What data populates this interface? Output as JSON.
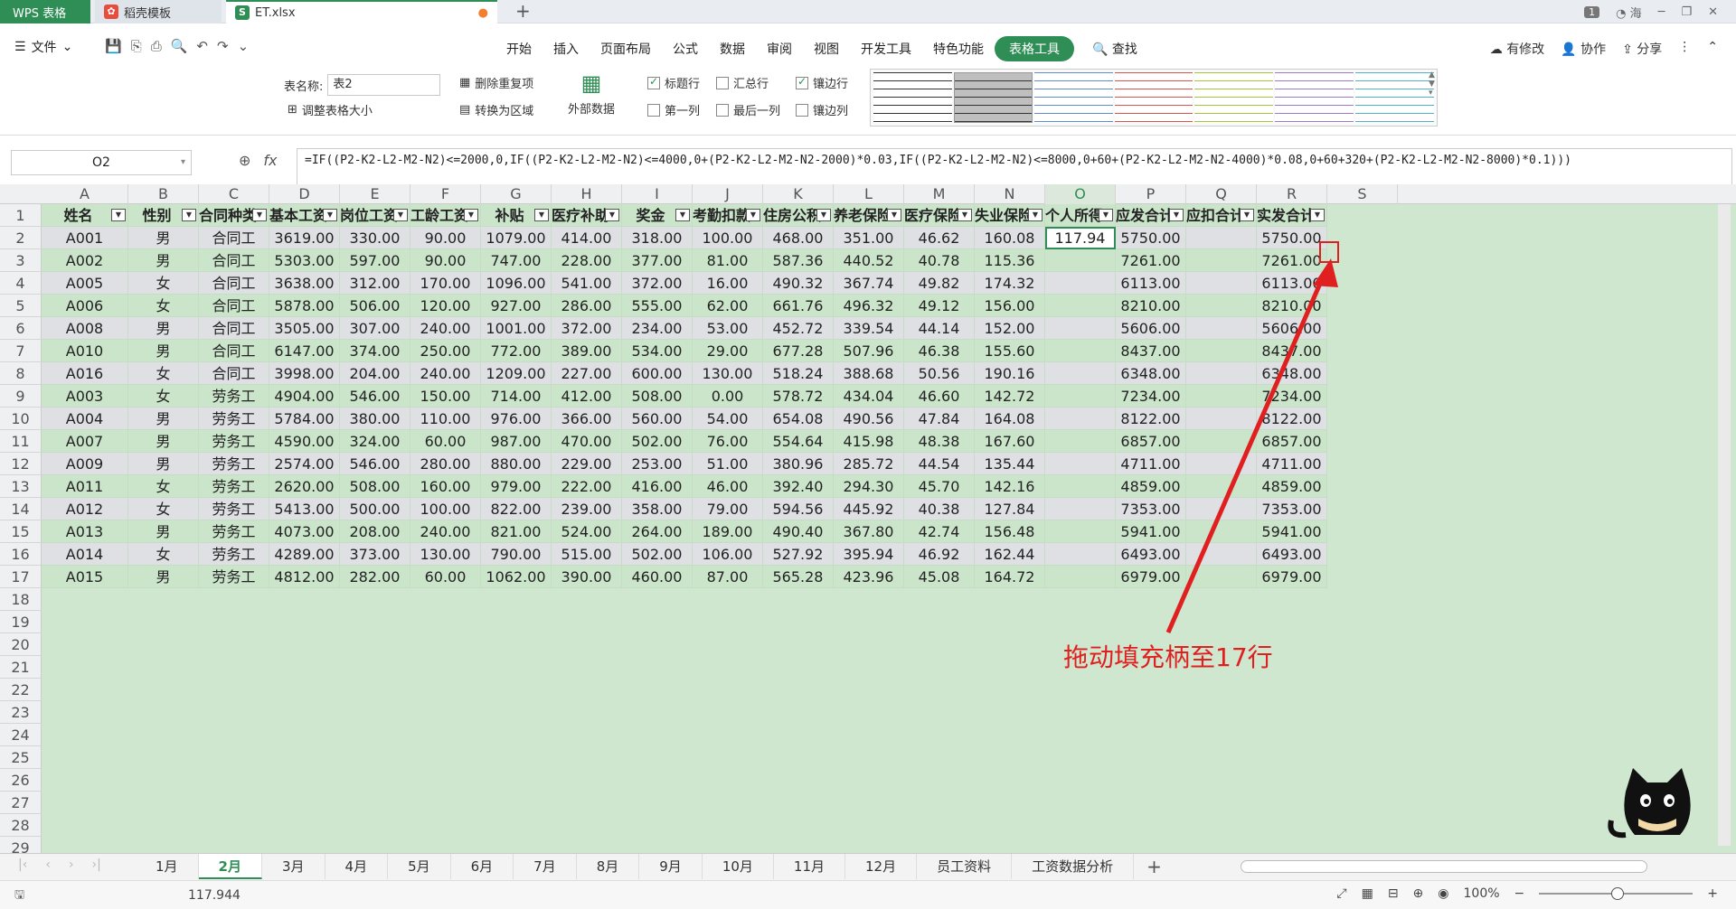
{
  "tabs": {
    "wps": "WPS 表格",
    "daoke": "稻壳模板",
    "file": "ET.xlsx",
    "badge": "1",
    "user": "海"
  },
  "menu": {
    "file": "文件",
    "ribbon_tabs": [
      "开始",
      "插入",
      "页面布局",
      "公式",
      "数据",
      "审阅",
      "视图",
      "开发工具",
      "特色功能",
      "表格工具"
    ],
    "search": "查找",
    "right": [
      "有修改",
      "协作",
      "分享"
    ]
  },
  "ribbon": {
    "table_name_label": "表名称:",
    "table_name_value": "表2",
    "resize": "调整表格大小",
    "remove_dup": "删除重复项",
    "to_range": "转换为区域",
    "external": "外部数据",
    "checks": [
      {
        "label": "标题行",
        "on": true
      },
      {
        "label": "汇总行",
        "on": false
      },
      {
        "label": "镶边行",
        "on": true
      },
      {
        "label": "第一列",
        "on": false
      },
      {
        "label": "最后一列",
        "on": false
      },
      {
        "label": "镶边列",
        "on": false
      }
    ],
    "style_colors": [
      "#333333",
      "#333333",
      "#5b8fd0",
      "#d9534f",
      "#a4c639",
      "#9b7bc8",
      "#4fb3c8"
    ]
  },
  "formula_bar": {
    "name_box": "O2",
    "formula": "=IF((P2-K2-L2-M2-N2)<=2000,0,IF((P2-K2-L2-M2-N2)<=4000,0+(P2-K2-L2-M2-N2-2000)*0.03,IF((P2-K2-L2-M2-N2)<=8000,0+60+(P2-K2-L2-M2-N2-4000)*0.08,0+60+320+(P2-K2-L2-M2-N2-8000)*0.1)))"
  },
  "columns": [
    "A",
    "B",
    "C",
    "D",
    "E",
    "F",
    "G",
    "H",
    "I",
    "J",
    "K",
    "L",
    "M",
    "N",
    "O",
    "P",
    "Q",
    "R",
    "S"
  ],
  "headers": [
    "姓名",
    "性别",
    "合同种类",
    "基本工资",
    "岗位工资",
    "工龄工资",
    "补贴",
    "医疗补助",
    "奖金",
    "考勤扣款",
    "住房公积",
    "养老保险",
    "医疗保险",
    "失业保险",
    "个人所得",
    "应发合计",
    "应扣合计",
    "实发合计"
  ],
  "rows": [
    [
      "A001",
      "男",
      "合同工",
      "3619.00",
      "330.00",
      "90.00",
      "1079.00",
      "414.00",
      "318.00",
      "100.00",
      "468.00",
      "351.00",
      "46.62",
      "160.08",
      "117.94",
      "5750.00",
      "",
      "5750.00"
    ],
    [
      "A002",
      "男",
      "合同工",
      "5303.00",
      "597.00",
      "90.00",
      "747.00",
      "228.00",
      "377.00",
      "81.00",
      "587.36",
      "440.52",
      "40.78",
      "115.36",
      "",
      "7261.00",
      "",
      "7261.00"
    ],
    [
      "A005",
      "女",
      "合同工",
      "3638.00",
      "312.00",
      "170.00",
      "1096.00",
      "541.00",
      "372.00",
      "16.00",
      "490.32",
      "367.74",
      "49.82",
      "174.32",
      "",
      "6113.00",
      "",
      "6113.00"
    ],
    [
      "A006",
      "女",
      "合同工",
      "5878.00",
      "506.00",
      "120.00",
      "927.00",
      "286.00",
      "555.00",
      "62.00",
      "661.76",
      "496.32",
      "49.12",
      "156.00",
      "",
      "8210.00",
      "",
      "8210.00"
    ],
    [
      "A008",
      "男",
      "合同工",
      "3505.00",
      "307.00",
      "240.00",
      "1001.00",
      "372.00",
      "234.00",
      "53.00",
      "452.72",
      "339.54",
      "44.14",
      "152.00",
      "",
      "5606.00",
      "",
      "5606.00"
    ],
    [
      "A010",
      "男",
      "合同工",
      "6147.00",
      "374.00",
      "250.00",
      "772.00",
      "389.00",
      "534.00",
      "29.00",
      "677.28",
      "507.96",
      "46.38",
      "155.60",
      "",
      "8437.00",
      "",
      "8437.00"
    ],
    [
      "A016",
      "女",
      "合同工",
      "3998.00",
      "204.00",
      "240.00",
      "1209.00",
      "227.00",
      "600.00",
      "130.00",
      "518.24",
      "388.68",
      "50.56",
      "190.16",
      "",
      "6348.00",
      "",
      "6348.00"
    ],
    [
      "A003",
      "女",
      "劳务工",
      "4904.00",
      "546.00",
      "150.00",
      "714.00",
      "412.00",
      "508.00",
      "0.00",
      "578.72",
      "434.04",
      "46.60",
      "142.72",
      "",
      "7234.00",
      "",
      "7234.00"
    ],
    [
      "A004",
      "男",
      "劳务工",
      "5784.00",
      "380.00",
      "110.00",
      "976.00",
      "366.00",
      "560.00",
      "54.00",
      "654.08",
      "490.56",
      "47.84",
      "164.08",
      "",
      "8122.00",
      "",
      "8122.00"
    ],
    [
      "A007",
      "男",
      "劳务工",
      "4590.00",
      "324.00",
      "60.00",
      "987.00",
      "470.00",
      "502.00",
      "76.00",
      "554.64",
      "415.98",
      "48.38",
      "167.60",
      "",
      "6857.00",
      "",
      "6857.00"
    ],
    [
      "A009",
      "男",
      "劳务工",
      "2574.00",
      "546.00",
      "280.00",
      "880.00",
      "229.00",
      "253.00",
      "51.00",
      "380.96",
      "285.72",
      "44.54",
      "135.44",
      "",
      "4711.00",
      "",
      "4711.00"
    ],
    [
      "A011",
      "女",
      "劳务工",
      "2620.00",
      "508.00",
      "160.00",
      "979.00",
      "222.00",
      "416.00",
      "46.00",
      "392.40",
      "294.30",
      "45.70",
      "142.16",
      "",
      "4859.00",
      "",
      "4859.00"
    ],
    [
      "A012",
      "女",
      "劳务工",
      "5413.00",
      "500.00",
      "100.00",
      "822.00",
      "239.00",
      "358.00",
      "79.00",
      "594.56",
      "445.92",
      "40.38",
      "127.84",
      "",
      "7353.00",
      "",
      "7353.00"
    ],
    [
      "A013",
      "男",
      "劳务工",
      "4073.00",
      "208.00",
      "240.00",
      "821.00",
      "524.00",
      "264.00",
      "189.00",
      "490.40",
      "367.80",
      "42.74",
      "156.48",
      "",
      "5941.00",
      "",
      "5941.00"
    ],
    [
      "A014",
      "女",
      "劳务工",
      "4289.00",
      "373.00",
      "130.00",
      "790.00",
      "515.00",
      "502.00",
      "106.00",
      "527.92",
      "395.94",
      "46.92",
      "162.44",
      "",
      "6493.00",
      "",
      "6493.00"
    ],
    [
      "A015",
      "男",
      "劳务工",
      "4812.00",
      "282.00",
      "60.00",
      "1062.00",
      "390.00",
      "460.00",
      "87.00",
      "565.28",
      "423.96",
      "45.08",
      "164.72",
      "",
      "6979.00",
      "",
      "6979.00"
    ]
  ],
  "row_numbers": [
    "1",
    "2",
    "3",
    "4",
    "5",
    "6",
    "7",
    "8",
    "9",
    "10",
    "11",
    "12",
    "13",
    "14",
    "15",
    "16",
    "17",
    "18",
    "19",
    "20",
    "21",
    "22",
    "23",
    "24",
    "25",
    "26",
    "27",
    "28",
    "29"
  ],
  "annotation": "拖动填充柄至17行",
  "sheet_tabs": [
    "1月",
    "2月",
    "3月",
    "4月",
    "5月",
    "6月",
    "7月",
    "8月",
    "9月",
    "10月",
    "11月",
    "12月",
    "员工资料",
    "工资数据分析"
  ],
  "active_sheet": "2月",
  "status": {
    "sum": "117.944",
    "zoom": "100%"
  }
}
